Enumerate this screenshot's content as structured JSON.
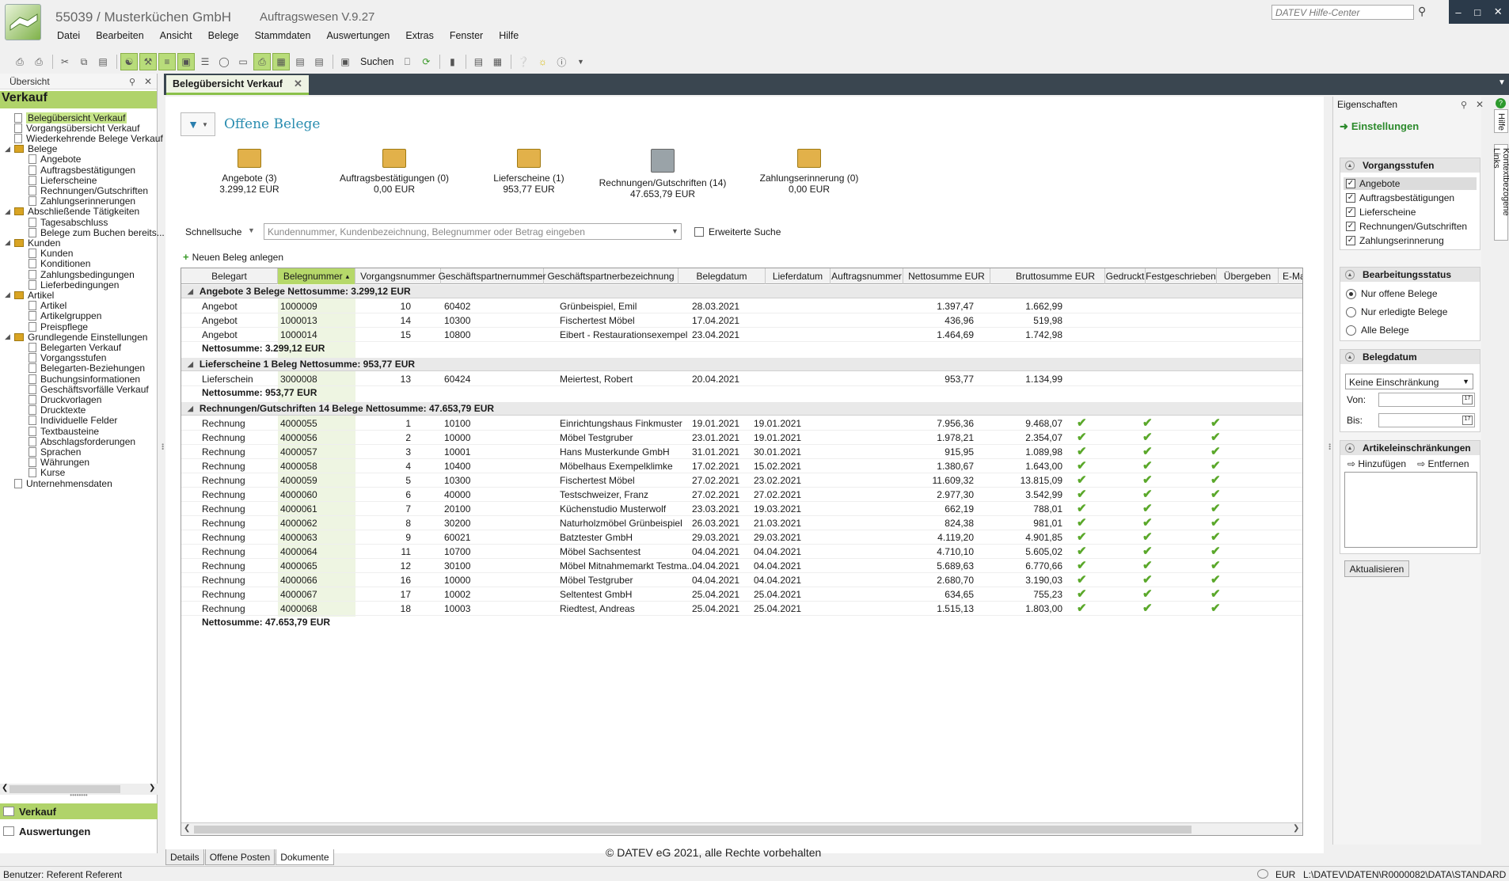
{
  "app": {
    "title": "55039 / Musterküchen GmbH",
    "version": "Auftragswesen V.9.27"
  },
  "menu": [
    "Datei",
    "Bearbeiten",
    "Ansicht",
    "Belege",
    "Stammdaten",
    "Auswertungen",
    "Extras",
    "Fenster",
    "Hilfe"
  ],
  "help_search": {
    "placeholder": "DATEV Hilfe-Center"
  },
  "toolbar": {
    "search_label": "Suchen"
  },
  "tab": {
    "label": "Belegübersicht Verkauf"
  },
  "left": {
    "header": "Übersicht",
    "title": "Verkauf",
    "tree": [
      {
        "label": "Belegübersicht Verkauf",
        "lvl": 1,
        "type": "doc",
        "sel": true
      },
      {
        "label": "Vorgangsübersicht Verkauf",
        "lvl": 1,
        "type": "doc"
      },
      {
        "label": "Wiederkehrende Belege Verkauf",
        "lvl": 1,
        "type": "doc"
      },
      {
        "label": "Belege",
        "lvl": 0,
        "type": "folder"
      },
      {
        "label": "Angebote",
        "lvl": 2,
        "type": "doc"
      },
      {
        "label": "Auftragsbestätigungen",
        "lvl": 2,
        "type": "doc"
      },
      {
        "label": "Lieferscheine",
        "lvl": 2,
        "type": "doc"
      },
      {
        "label": "Rechnungen/Gutschriften",
        "lvl": 2,
        "type": "doc"
      },
      {
        "label": "Zahlungserinnerungen",
        "lvl": 2,
        "type": "doc"
      },
      {
        "label": "Abschließende Tätigkeiten",
        "lvl": 0,
        "type": "folder"
      },
      {
        "label": "Tagesabschluss",
        "lvl": 2,
        "type": "doc"
      },
      {
        "label": "Belege zum Buchen bereits...",
        "lvl": 2,
        "type": "doc"
      },
      {
        "label": "Kunden",
        "lvl": 0,
        "type": "folder"
      },
      {
        "label": "Kunden",
        "lvl": 2,
        "type": "doc"
      },
      {
        "label": "Konditionen",
        "lvl": 2,
        "type": "doc"
      },
      {
        "label": "Zahlungsbedingungen",
        "lvl": 2,
        "type": "doc"
      },
      {
        "label": "Lieferbedingungen",
        "lvl": 2,
        "type": "doc"
      },
      {
        "label": "Artikel",
        "lvl": 0,
        "type": "folder"
      },
      {
        "label": "Artikel",
        "lvl": 2,
        "type": "doc"
      },
      {
        "label": "Artikelgruppen",
        "lvl": 2,
        "type": "doc"
      },
      {
        "label": "Preispflege",
        "lvl": 2,
        "type": "doc"
      },
      {
        "label": "Grundlegende Einstellungen",
        "lvl": 0,
        "type": "folder"
      },
      {
        "label": "Belegarten Verkauf",
        "lvl": 2,
        "type": "doc"
      },
      {
        "label": "Vorgangsstufen",
        "lvl": 2,
        "type": "doc"
      },
      {
        "label": "Belegarten-Beziehungen",
        "lvl": 2,
        "type": "doc"
      },
      {
        "label": "Buchungsinformationen",
        "lvl": 2,
        "type": "doc"
      },
      {
        "label": "Geschäftsvorfälle Verkauf",
        "lvl": 2,
        "type": "doc"
      },
      {
        "label": "Druckvorlagen",
        "lvl": 2,
        "type": "doc"
      },
      {
        "label": "Drucktexte",
        "lvl": 2,
        "type": "doc"
      },
      {
        "label": "Individuelle Felder",
        "lvl": 2,
        "type": "doc"
      },
      {
        "label": "Textbausteine",
        "lvl": 2,
        "type": "doc"
      },
      {
        "label": "Abschlagsforderungen",
        "lvl": 2,
        "type": "doc"
      },
      {
        "label": "Sprachen",
        "lvl": 2,
        "type": "doc"
      },
      {
        "label": "Währungen",
        "lvl": 2,
        "type": "doc"
      },
      {
        "label": "Kurse",
        "lvl": 2,
        "type": "doc"
      },
      {
        "label": "Unternehmensdaten",
        "lvl": 1,
        "type": "doc"
      }
    ],
    "nav_verkauf": "Verkauf",
    "nav_auswertungen": "Auswertungen"
  },
  "main": {
    "title": "Offene Belege",
    "cards": [
      {
        "label": "Angebote (3)",
        "amount": "3.299,12 EUR",
        "icon": "tray-icon"
      },
      {
        "label": "Auftragsbestätigungen (0)",
        "amount": "0,00 EUR",
        "icon": "tray-icon"
      },
      {
        "label": "Lieferscheine (1)",
        "amount": "953,77 EUR",
        "icon": "tray-icon"
      },
      {
        "label": "Rechnungen/Gutschriften (14)",
        "amount": "47.653,79 EUR",
        "icon": "stack-icon"
      },
      {
        "label": "Zahlungserinnerung (0)",
        "amount": "0,00 EUR",
        "icon": "tray-icon"
      }
    ],
    "quicksearch": {
      "label": "Schnellsuche",
      "placeholder": "Kundennummer, Kundenbezeichnung, Belegnummer oder Betrag eingeben",
      "extended": "Erweiterte Suche"
    },
    "new_label": "Neuen Beleg anlegen",
    "columns": [
      "Belegart",
      "Belegnummer",
      "Vorgangsnummer",
      "Geschäftspartnernummer",
      "Geschäftspartnerbezeichnung",
      "Belegdatum",
      "Lieferdatum",
      "Auftragsnummer",
      "Nettosumme EUR",
      "Bruttosumme EUR",
      "Gedruckt",
      "Festgeschrieben",
      "Übergeben",
      "E-Mail"
    ],
    "groups": [
      {
        "header": "Angebote 3 Belege Nettosumme: 3.299,12 EUR",
        "summary": "Nettosumme: 3.299,12 EUR",
        "rows": [
          [
            "Angebot",
            "1000009",
            "10",
            "60402",
            "Grünbeispiel, Emil",
            "28.03.2021",
            "",
            "",
            "1.397,47",
            "1.662,99",
            false,
            false,
            false
          ],
          [
            "Angebot",
            "1000013",
            "14",
            "10300",
            "Fischertest Möbel",
            "17.04.2021",
            "",
            "",
            "436,96",
            "519,98",
            false,
            false,
            false
          ],
          [
            "Angebot",
            "1000014",
            "15",
            "10800",
            "Eibert - Restaurationsexempel",
            "23.04.2021",
            "",
            "",
            "1.464,69",
            "1.742,98",
            false,
            false,
            false
          ]
        ]
      },
      {
        "header": "Lieferscheine 1 Beleg Nettosumme: 953,77 EUR",
        "summary": "Nettosumme: 953,77 EUR",
        "rows": [
          [
            "Lieferschein",
            "3000008",
            "13",
            "60424",
            "Meiertest, Robert",
            "20.04.2021",
            "",
            "",
            "953,77",
            "1.134,99",
            false,
            false,
            false
          ]
        ]
      },
      {
        "header": "Rechnungen/Gutschriften 14 Belege Nettosumme: 47.653,79 EUR",
        "summary": "Nettosumme: 47.653,79 EUR",
        "rows": [
          [
            "Rechnung",
            "4000055",
            "1",
            "10100",
            "Einrichtungshaus Finkmuster",
            "19.01.2021",
            "19.01.2021",
            "",
            "7.956,36",
            "9.468,07",
            true,
            true,
            true
          ],
          [
            "Rechnung",
            "4000056",
            "2",
            "10000",
            "Möbel Testgruber",
            "23.01.2021",
            "19.01.2021",
            "",
            "1.978,21",
            "2.354,07",
            true,
            true,
            true
          ],
          [
            "Rechnung",
            "4000057",
            "3",
            "10001",
            "Hans Musterkunde GmbH",
            "31.01.2021",
            "30.01.2021",
            "",
            "915,95",
            "1.089,98",
            true,
            true,
            true
          ],
          [
            "Rechnung",
            "4000058",
            "4",
            "10400",
            "Möbelhaus Exempelklimke",
            "17.02.2021",
            "15.02.2021",
            "",
            "1.380,67",
            "1.643,00",
            true,
            true,
            true
          ],
          [
            "Rechnung",
            "4000059",
            "5",
            "10300",
            "Fischertest Möbel",
            "27.02.2021",
            "23.02.2021",
            "",
            "11.609,32",
            "13.815,09",
            true,
            true,
            true
          ],
          [
            "Rechnung",
            "4000060",
            "6",
            "40000",
            "Testschweizer, Franz",
            "27.02.2021",
            "27.02.2021",
            "",
            "2.977,30",
            "3.542,99",
            true,
            true,
            true
          ],
          [
            "Rechnung",
            "4000061",
            "7",
            "20100",
            "Küchenstudio Musterwolf",
            "23.03.2021",
            "19.03.2021",
            "",
            "662,19",
            "788,01",
            true,
            true,
            true
          ],
          [
            "Rechnung",
            "4000062",
            "8",
            "30200",
            "Naturholzmöbel Grünbeispiel",
            "26.03.2021",
            "21.03.2021",
            "",
            "824,38",
            "981,01",
            true,
            true,
            true
          ],
          [
            "Rechnung",
            "4000063",
            "9",
            "60021",
            "Batztester GmbH",
            "29.03.2021",
            "29.03.2021",
            "",
            "4.119,20",
            "4.901,85",
            true,
            true,
            true
          ],
          [
            "Rechnung",
            "4000064",
            "11",
            "10700",
            "Möbel Sachsentest",
            "04.04.2021",
            "04.04.2021",
            "",
            "4.710,10",
            "5.605,02",
            true,
            true,
            true
          ],
          [
            "Rechnung",
            "4000065",
            "12",
            "30100",
            "Möbel Mitnahmemarkt Testma...",
            "04.04.2021",
            "04.04.2021",
            "",
            "5.689,63",
            "6.770,66",
            true,
            true,
            true
          ],
          [
            "Rechnung",
            "4000066",
            "16",
            "10000",
            "Möbel Testgruber",
            "04.04.2021",
            "04.04.2021",
            "",
            "2.680,70",
            "3.190,03",
            true,
            true,
            true
          ],
          [
            "Rechnung",
            "4000067",
            "17",
            "10002",
            "Seltentest GmbH",
            "25.04.2021",
            "25.04.2021",
            "",
            "634,65",
            "755,23",
            true,
            true,
            true
          ],
          [
            "Rechnung",
            "4000068",
            "18",
            "10003",
            "Riedtest, Andreas",
            "25.04.2021",
            "25.04.2021",
            "",
            "1.515,13",
            "1.803,00",
            true,
            true,
            true
          ]
        ]
      }
    ],
    "copyright": "© DATEV eG 2021, alle Rechte vorbehalten",
    "bottom_tabs": [
      "Details",
      "Offene Posten",
      "Dokumente"
    ]
  },
  "right": {
    "header": "Eigenschaften",
    "settings": "Einstellungen",
    "vorgangsstufen": {
      "title": "Vorgangsstufen",
      "items": [
        "Angebote",
        "Auftragsbestätigungen",
        "Lieferscheine",
        "Rechnungen/Gutschriften",
        "Zahlungserinnerung"
      ]
    },
    "status": {
      "title": "Bearbeitungsstatus",
      "options": [
        "Nur offene Belege",
        "Nur erledigte Belege",
        "Alle Belege"
      ]
    },
    "belegdatum": {
      "title": "Belegdatum",
      "select": "Keine Einschränkung",
      "von": "Von:",
      "bis": "Bis:"
    },
    "artikel": {
      "title": "Artikeleinschränkungen",
      "add": "Hinzufügen",
      "remove": "Entfernen"
    },
    "refresh": "Aktualisieren",
    "vtabs": [
      "Hilfe",
      "Kontextbezogene Links"
    ]
  },
  "status": {
    "user": "Benutzer: Referent Referent",
    "currency": "EUR",
    "path": "L:\\DATEV\\DATEN\\R0000082\\DATA\\STANDARD"
  },
  "colors": {
    "accent": "#b0d36a",
    "title": "#2a8db0",
    "check": "#5aa82a"
  }
}
